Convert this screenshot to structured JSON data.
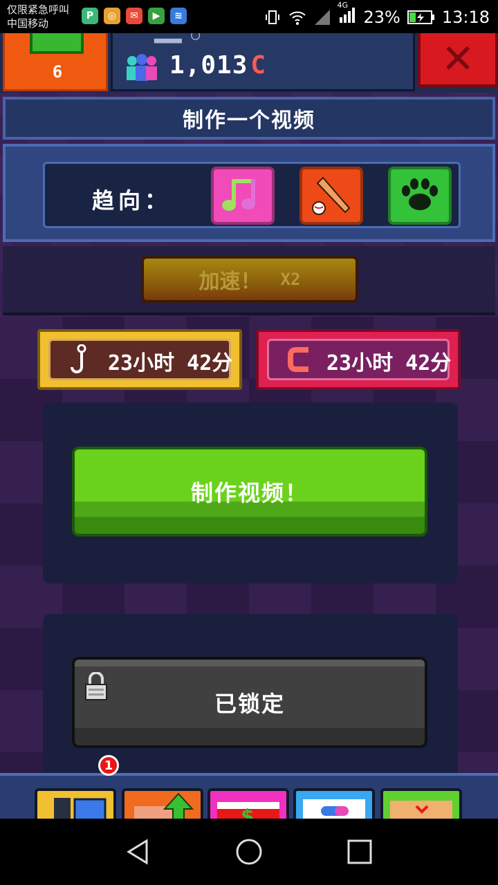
{
  "status_bar": {
    "carrier_line1": "仅限紧急呼叫",
    "carrier_line2": "中国移动",
    "network": "4G",
    "battery": "23%",
    "time": "13:18"
  },
  "header": {
    "level": "6",
    "subscribers": "1,013",
    "currency_glyph": "C"
  },
  "title": "制作一个视频",
  "trend": {
    "label": "趋向：",
    "topics": [
      "music-icon",
      "baseball-icon",
      "paw-icon"
    ]
  },
  "boost": {
    "label": "加速！",
    "multiplier": "X2"
  },
  "timers": {
    "views": "23小时 42分",
    "coins": "23小时 42分"
  },
  "actions": {
    "make_video": "制作视频！",
    "locked": "已锁定"
  },
  "toolbar": {
    "badge": "1"
  }
}
